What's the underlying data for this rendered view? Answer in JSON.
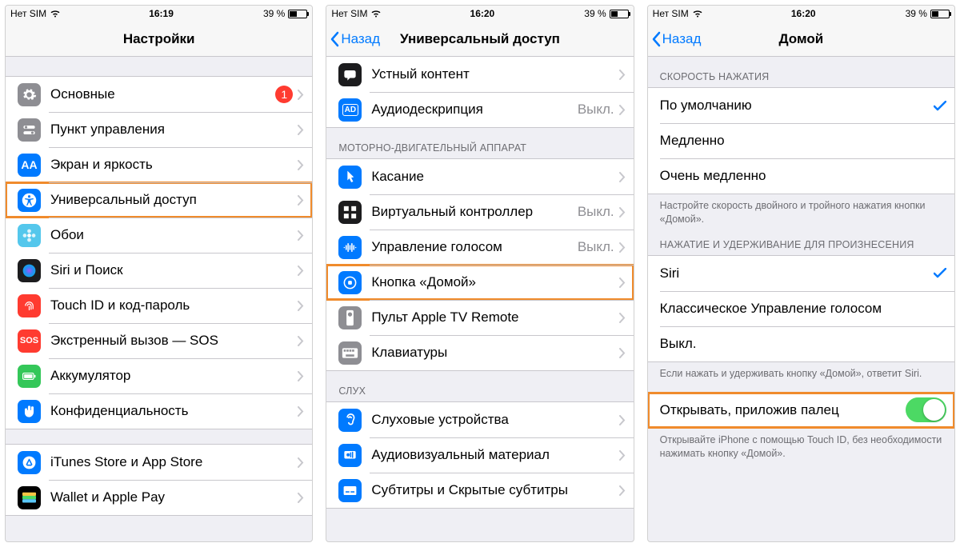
{
  "status": {
    "carrier": "Нет SIM",
    "battery_pct": "39 %"
  },
  "times": [
    "16:19",
    "16:20",
    "16:20"
  ],
  "screen1": {
    "title": "Настройки",
    "group_a": [
      {
        "name": "general",
        "icon": "gear",
        "bg": "#8e8e93",
        "label": "Основные",
        "badge": "1"
      },
      {
        "name": "control-center",
        "icon": "switches",
        "bg": "#8e8e93",
        "label": "Пункт управления"
      },
      {
        "name": "display",
        "icon": "aa",
        "bg": "#007aff",
        "label": "Экран и яркость"
      },
      {
        "name": "accessibility",
        "icon": "accessibility",
        "bg": "#007aff",
        "label": "Универсальный доступ",
        "hl": true
      },
      {
        "name": "wallpaper",
        "icon": "flower",
        "bg": "#54c7ec",
        "label": "Обои"
      },
      {
        "name": "siri",
        "icon": "siri",
        "bg": "#1c1c1e",
        "label": "Siri и Поиск"
      },
      {
        "name": "touchid",
        "icon": "fingerprint",
        "bg": "#ff3b30",
        "label": "Touch ID и код-пароль"
      },
      {
        "name": "sos",
        "icon": "sos",
        "bg": "#ff3b30",
        "label": "Экстренный вызов — SOS"
      },
      {
        "name": "battery",
        "icon": "battery",
        "bg": "#34c759",
        "label": "Аккумулятор"
      },
      {
        "name": "privacy",
        "icon": "hand",
        "bg": "#007aff",
        "label": "Конфиденциальность"
      }
    ],
    "group_b": [
      {
        "name": "itunes",
        "icon": "appstore",
        "bg": "#007aff",
        "label": "iTunes Store и App Store"
      },
      {
        "name": "wallet",
        "icon": "wallet",
        "bg": "#000000",
        "label": "Wallet и Apple Pay"
      }
    ]
  },
  "screen2": {
    "back": "Назад",
    "title": "Универсальный доступ",
    "group_a": [
      {
        "name": "spoken-content",
        "icon": "speech",
        "bg": "#1c1c1e",
        "label": "Устный контент"
      },
      {
        "name": "audio-description",
        "icon": "ad",
        "bg": "#007aff",
        "label": "Аудиодескрипция",
        "value": "Выкл."
      }
    ],
    "header_motor": "МОТОРНО-ДВИГАТЕЛЬНЫЙ АППАРАТ",
    "group_motor": [
      {
        "name": "touch",
        "icon": "pointer",
        "bg": "#007aff",
        "label": "Касание"
      },
      {
        "name": "switch-control",
        "icon": "grid",
        "bg": "#1c1c1e",
        "label": "Виртуальный контроллер",
        "value": "Выкл."
      },
      {
        "name": "voice-control",
        "icon": "voicewave",
        "bg": "#007aff",
        "label": "Управление голосом",
        "value": "Выкл."
      },
      {
        "name": "home-button",
        "icon": "home",
        "bg": "#007aff",
        "label": "Кнопка «Домой»",
        "hl": true
      },
      {
        "name": "apple-tv-remote",
        "icon": "remote",
        "bg": "#8e8e93",
        "label": "Пульт Apple TV Remote"
      },
      {
        "name": "keyboards",
        "icon": "keyboard",
        "bg": "#8e8e93",
        "label": "Клавиатуры"
      }
    ],
    "header_hearing": "СЛУХ",
    "group_hearing": [
      {
        "name": "hearing-devices",
        "icon": "ear",
        "bg": "#007aff",
        "label": "Слуховые устройства"
      },
      {
        "name": "audiovisual",
        "icon": "avmat",
        "bg": "#007aff",
        "label": "Аудиовизуальный материал"
      },
      {
        "name": "subtitles",
        "icon": "sub",
        "bg": "#007aff",
        "label": "Субтитры и Скрытые субтитры"
      }
    ]
  },
  "screen3": {
    "back": "Назад",
    "title": "Домой",
    "header_speed": "СКОРОСТЬ НАЖАТИЯ",
    "speed_options": [
      {
        "label": "По умолчанию",
        "checked": true
      },
      {
        "label": "Медленно"
      },
      {
        "label": "Очень медленно"
      }
    ],
    "footer_speed": "Настройте скорость двойного и тройного нажатия кнопки «Домой».",
    "header_hold": "НАЖАТИЕ И УДЕРЖИВАНИЕ ДЛЯ ПРОИЗНЕСЕНИЯ",
    "hold_options": [
      {
        "label": "Siri",
        "checked": true
      },
      {
        "label": "Классическое Управление голосом"
      },
      {
        "label": "Выкл."
      }
    ],
    "footer_hold": "Если нажать и удерживать кнопку «Домой», ответит Siri.",
    "rest_finger": {
      "label": "Открывать, приложив палец",
      "on": true,
      "hl": true
    },
    "footer_rest": "Открывайте iPhone с помощью Touch ID, без необходимости нажимать кнопку «Домой»."
  }
}
